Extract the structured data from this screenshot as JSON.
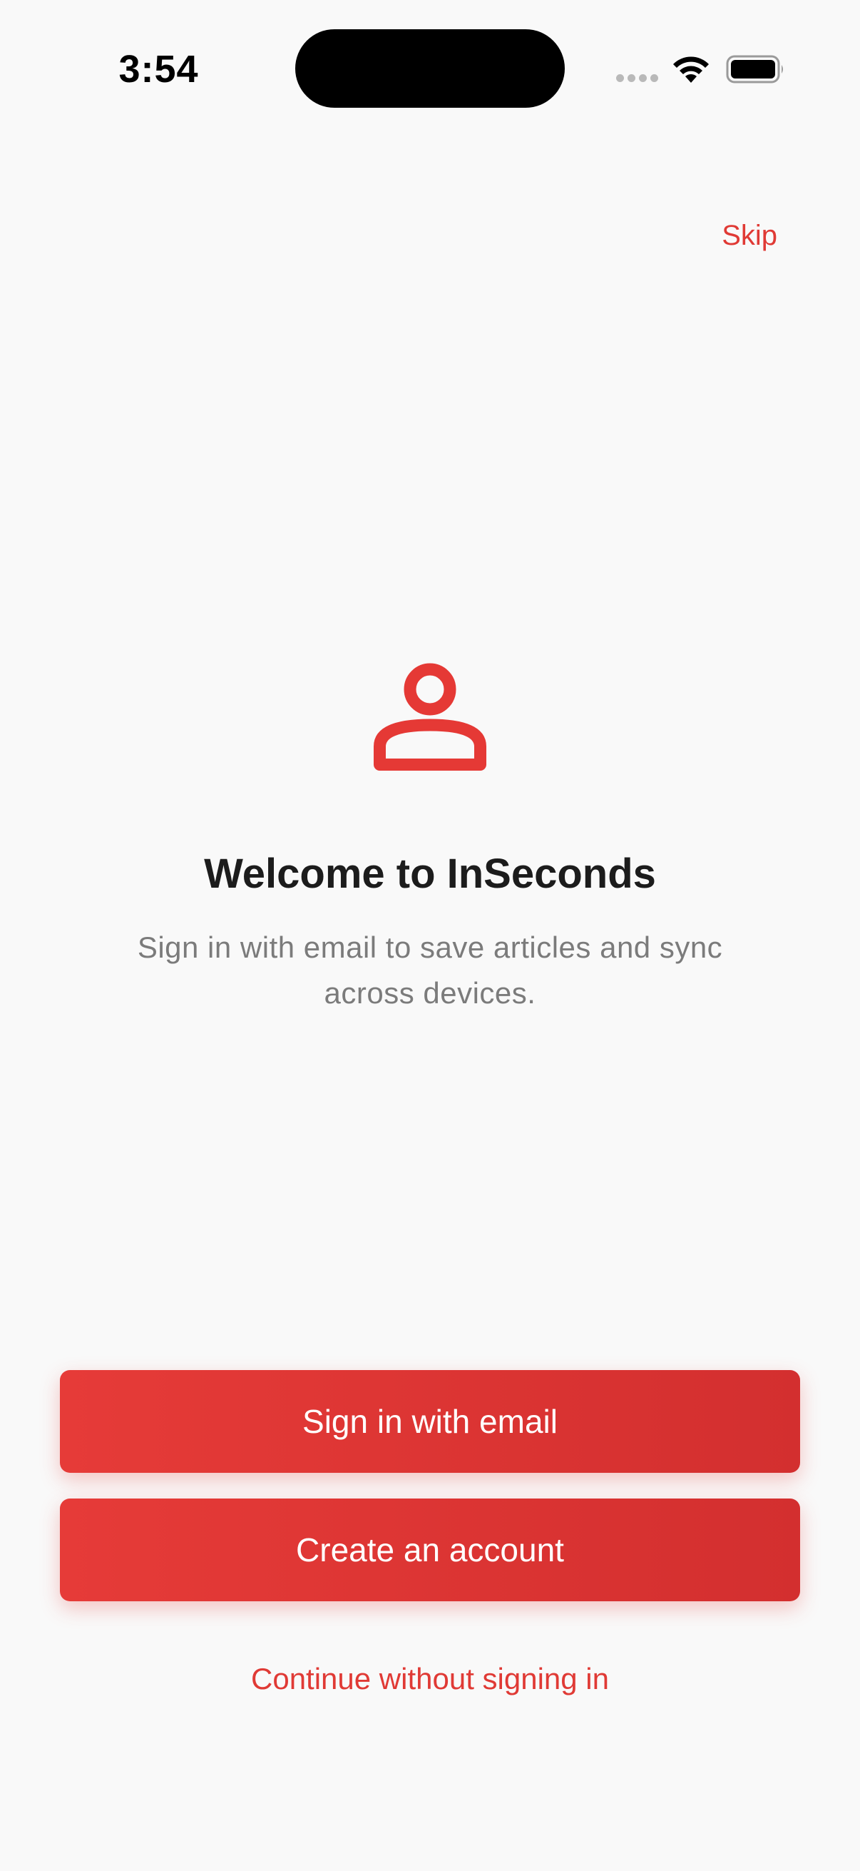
{
  "status_bar": {
    "time": "3:54"
  },
  "header": {
    "skip_label": "Skip"
  },
  "hero": {
    "icon": "person-icon",
    "title": "Welcome to InSeconds",
    "subtitle": "Sign in with email to save articles and sync across devices."
  },
  "actions": {
    "sign_in_label": "Sign in with email",
    "create_account_label": "Create an account",
    "continue_label": "Continue without signing in"
  },
  "colors": {
    "accent": "#e53935",
    "accent_dark": "#d32f2f",
    "background": "#f9f9f9",
    "title_text": "#1c1c1c",
    "subtitle_text": "#7b7b7b"
  }
}
